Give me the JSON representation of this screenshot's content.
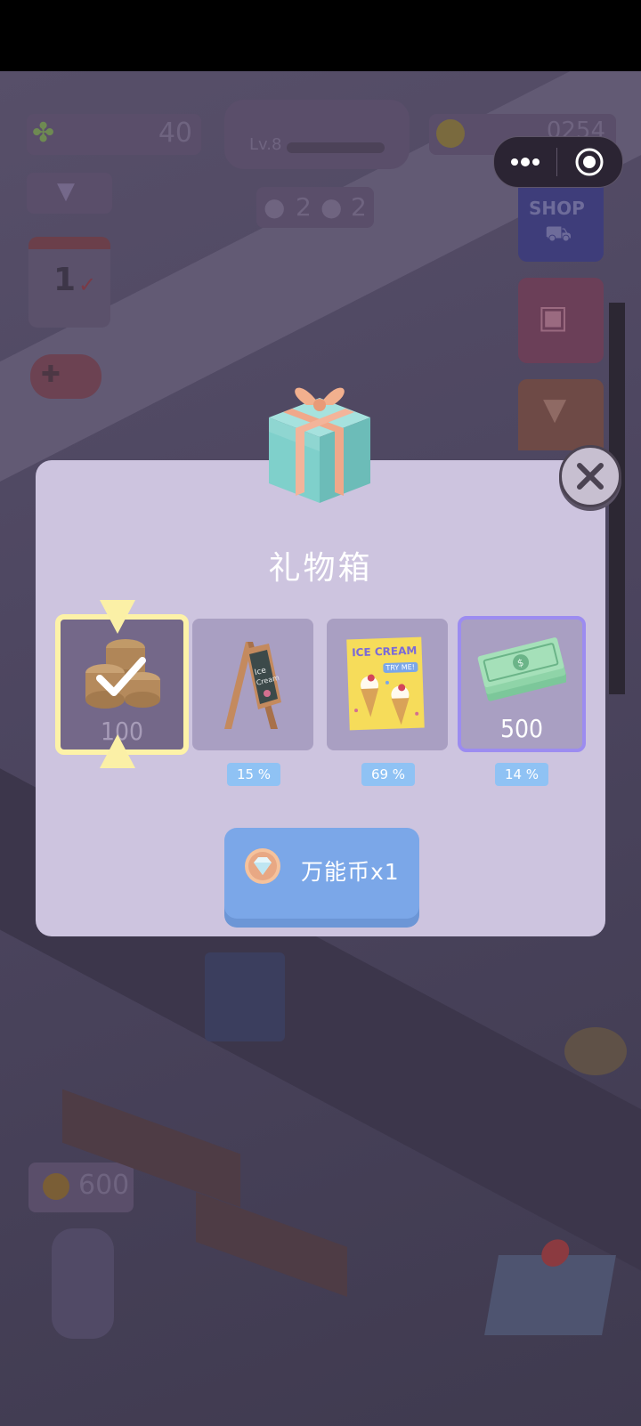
{
  "status_bar": {},
  "hud": {
    "clover_count": "40",
    "coin_count": "0254",
    "level_text": "Lv.8",
    "pets": {
      "dogs": "2",
      "cats": "2"
    },
    "calendar_day": "1",
    "shop_label": "SHOP",
    "jar_coins": "600"
  },
  "mini_program_menu": {
    "more_icon": "ellipsis-icon",
    "close_icon": "target-circle-icon"
  },
  "dialog": {
    "title": "礼物箱",
    "rewards": [
      {
        "name": "coins",
        "label": "100",
        "selected": true,
        "percent": ""
      },
      {
        "name": "chalkboard-sign",
        "label": "",
        "percent": "15 %"
      },
      {
        "name": "ice-cream-poster",
        "label": "",
        "poster_title": "ICE CREAM",
        "poster_sub": "TRY ME!",
        "percent": "69 %"
      },
      {
        "name": "cash-stack",
        "label": "500",
        "percent": "14 %"
      }
    ],
    "redeem_button": {
      "label": "万能币x1",
      "icon": "diamond-coin-icon"
    }
  },
  "colors": {
    "dialog_bg": "#cdc4df",
    "card_bg": "#a99fc2",
    "selected_border": "#fdf2a8",
    "cash_border": "#9c8cf0",
    "percent_bg": "#8fc2f4",
    "button_bg": "#7ba7e8"
  }
}
